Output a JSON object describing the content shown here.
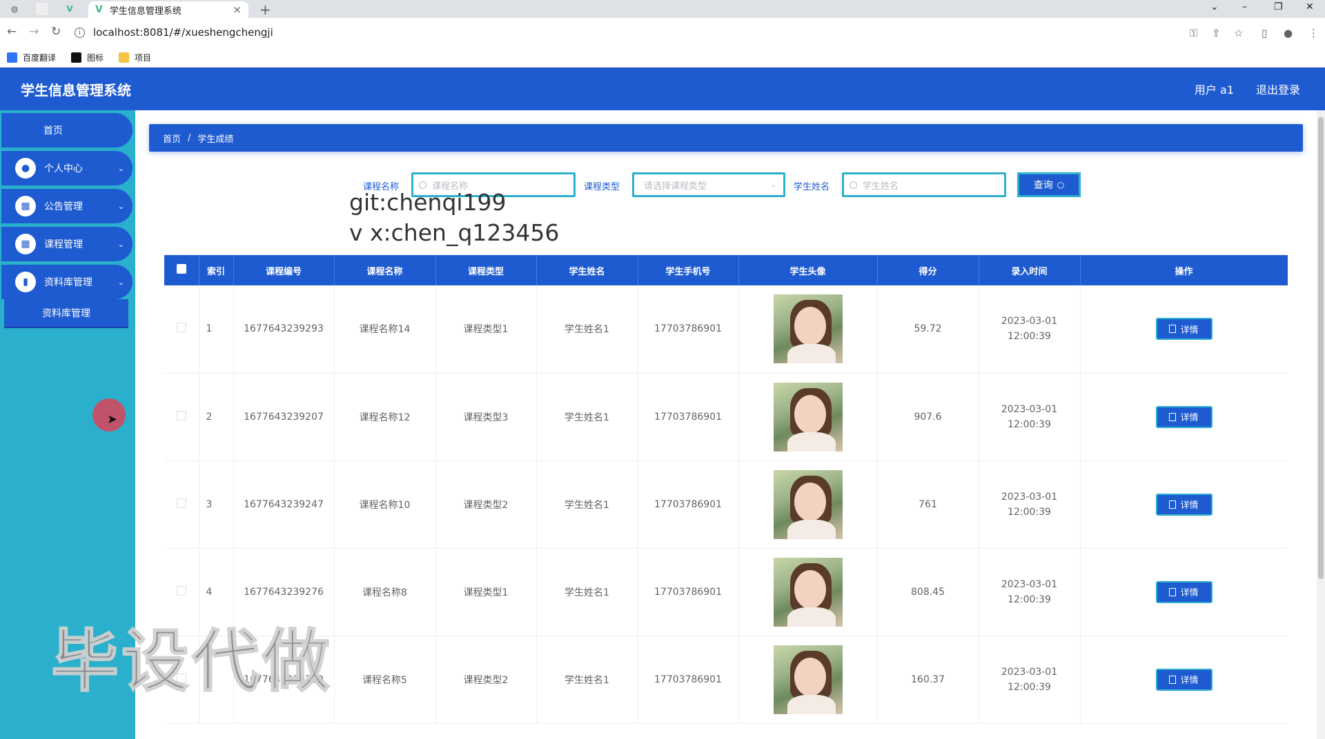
{
  "browser": {
    "tab_title": "学生信息管理系统",
    "url": "localhost:8081/#/xueshengchengji",
    "bookmarks": [
      "百度翻译",
      "图标",
      "项目"
    ]
  },
  "header": {
    "title": "学生信息管理系统",
    "user": "用户 a1",
    "logout": "退出登录"
  },
  "sidebar": {
    "items": [
      {
        "label": "首页"
      },
      {
        "label": "个人中心"
      },
      {
        "label": "公告管理"
      },
      {
        "label": "课程管理"
      },
      {
        "label": "资料库管理"
      }
    ],
    "sub_item": "资料库管理"
  },
  "breadcrumb": {
    "home": "首页",
    "sep": "/",
    "current": "学生成绩"
  },
  "search": {
    "course_name_label": "课程名称",
    "course_name_placeholder": "课程名称",
    "course_type_label": "课程类型",
    "course_type_placeholder": "请选择课程类型",
    "student_name_label": "学生姓名",
    "student_name_placeholder": "学生姓名",
    "query_button": "查询"
  },
  "watermarks": {
    "git": "git:chenqi199",
    "vx": "v x:chen_q123456",
    "big": "毕设代做"
  },
  "table": {
    "headers": [
      "索引",
      "课程编号",
      "课程名称",
      "课程类型",
      "学生姓名",
      "学生手机号",
      "学生头像",
      "得分",
      "录入时间",
      "操作"
    ],
    "detail_label": "详情",
    "rows": [
      {
        "index": "1",
        "course_no": "1677643239293",
        "course_name": "课程名称14",
        "course_type": "课程类型1",
        "student": "学生姓名1",
        "phone": "17703786901",
        "score": "59.72",
        "time": "2023-03-01 12:00:39"
      },
      {
        "index": "2",
        "course_no": "1677643239207",
        "course_name": "课程名称12",
        "course_type": "课程类型3",
        "student": "学生姓名1",
        "phone": "17703786901",
        "score": "907.6",
        "time": "2023-03-01 12:00:39"
      },
      {
        "index": "3",
        "course_no": "1677643239247",
        "course_name": "课程名称10",
        "course_type": "课程类型2",
        "student": "学生姓名1",
        "phone": "17703786901",
        "score": "761",
        "time": "2023-03-01 12:00:39"
      },
      {
        "index": "4",
        "course_no": "1677643239276",
        "course_name": "课程名称8",
        "course_type": "课程类型1",
        "student": "学生姓名1",
        "phone": "17703786901",
        "score": "808.45",
        "time": "2023-03-01 12:00:39"
      },
      {
        "index": "5",
        "course_no": "1677643239239",
        "course_name": "课程名称5",
        "course_type": "课程类型2",
        "student": "学生姓名1",
        "phone": "17703786901",
        "score": "160.37",
        "time": "2023-03-01 12:00:39"
      }
    ]
  },
  "colors": {
    "primary": "#1e5bd1",
    "sidebar": "#2ab0cc"
  }
}
